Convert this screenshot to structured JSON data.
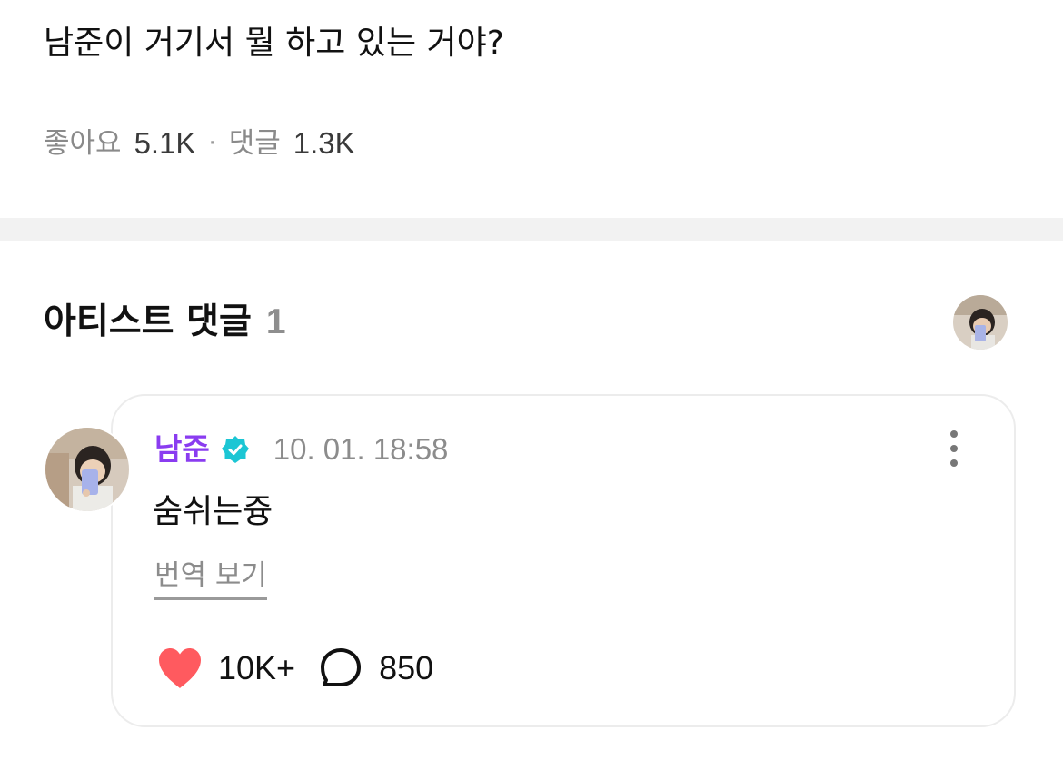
{
  "post": {
    "text": "남준이 거기서 뭘 하고 있는 거야?",
    "likes_label": "좋아요",
    "likes_value": "5.1K",
    "separator": "·",
    "comments_label": "댓글",
    "comments_value": "1.3K"
  },
  "artist_comments": {
    "title": "아티스트 댓글",
    "count": "1",
    "header_avatar_icon": "artist-avatar"
  },
  "comment": {
    "author": "남준",
    "verified_icon": "verified-badge-icon",
    "timestamp": "10. 01. 18:58",
    "more_icon": "more-vertical-icon",
    "body": "숨쉬는즁",
    "translate_label": "번역 보기",
    "like_icon": "heart-icon",
    "like_count": "10K+",
    "reply_icon": "speech-bubble-icon",
    "reply_count": "850"
  },
  "colors": {
    "author": "#8a3cf0",
    "verified": "#1cc6d4",
    "heart": "#ff5a5f",
    "muted": "#8c8c8c",
    "band": "#f2f2f2"
  }
}
